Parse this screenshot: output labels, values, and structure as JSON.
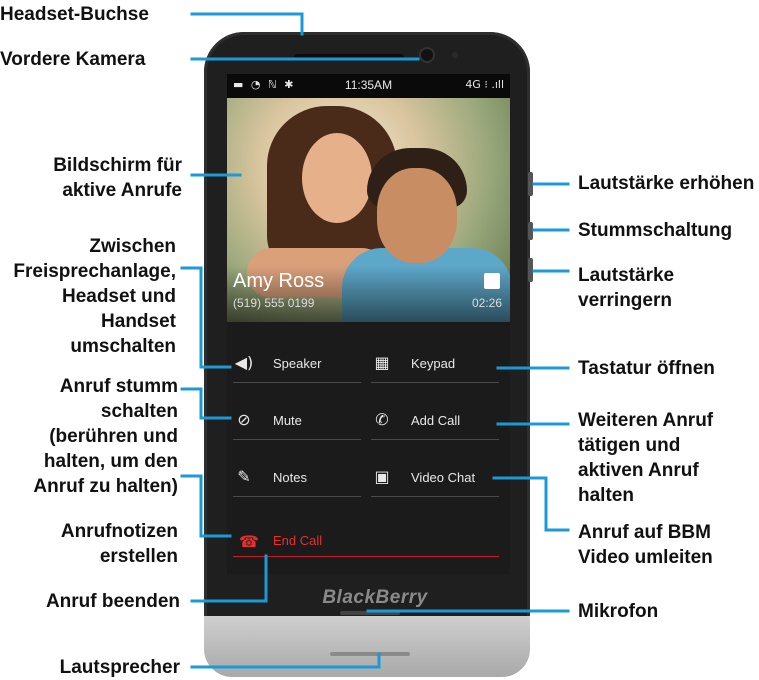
{
  "callouts_left": [
    {
      "id": "headset-jack",
      "text": "Headset-Buchse"
    },
    {
      "id": "front-camera",
      "text": "Vordere Kamera"
    },
    {
      "id": "active-call-screen",
      "text": "Bildschirm für aktive Anrufe"
    },
    {
      "id": "switch-audio",
      "text": "Zwischen Freisprechanlage, Headset und Handset umschalten"
    },
    {
      "id": "mute-call",
      "text": "Anruf stumm schalten (berühren und halten, um den Anruf zu halten)"
    },
    {
      "id": "call-notes",
      "text": "Anrufnotizen erstellen"
    },
    {
      "id": "end-call",
      "text": "Anruf beenden"
    },
    {
      "id": "speaker",
      "text": "Lautsprecher"
    }
  ],
  "callouts_right": [
    {
      "id": "volume-up",
      "text": "Lautstärke erhöhen"
    },
    {
      "id": "mute-key",
      "text": "Stummschaltung"
    },
    {
      "id": "volume-down",
      "text": "Lautstärke verringern"
    },
    {
      "id": "open-keypad",
      "text": "Tastatur öffnen"
    },
    {
      "id": "add-call",
      "text": "Weiteren Anruf tätigen und aktiven Anruf halten"
    },
    {
      "id": "bbm-video",
      "text": "Anruf auf BBM Video umleiten"
    },
    {
      "id": "microphone",
      "text": "Mikrofon"
    }
  ],
  "phone": {
    "brand": "BlackBerry",
    "status_bar": {
      "time": "11:35AM",
      "network": "4G"
    },
    "caller": {
      "name": "Amy Ross",
      "number": "(519) 555 0199",
      "duration": "02:26"
    },
    "buttons": [
      {
        "id": "speaker",
        "label": "Speaker",
        "icon": "speaker-icon"
      },
      {
        "id": "keypad",
        "label": "Keypad",
        "icon": "keypad-icon"
      },
      {
        "id": "mute",
        "label": "Mute",
        "icon": "mute-mic-icon"
      },
      {
        "id": "add-call",
        "label": "Add Call",
        "icon": "add-call-icon"
      },
      {
        "id": "notes",
        "label": "Notes",
        "icon": "notes-icon"
      },
      {
        "id": "video-chat",
        "label": "Video Chat",
        "icon": "video-chat-icon"
      }
    ],
    "end_call": {
      "label": "End Call",
      "icon": "hangup-icon",
      "color": "#e53030"
    }
  },
  "colors": {
    "leader_line": "#1a9bd7",
    "label_text": "#111111"
  }
}
